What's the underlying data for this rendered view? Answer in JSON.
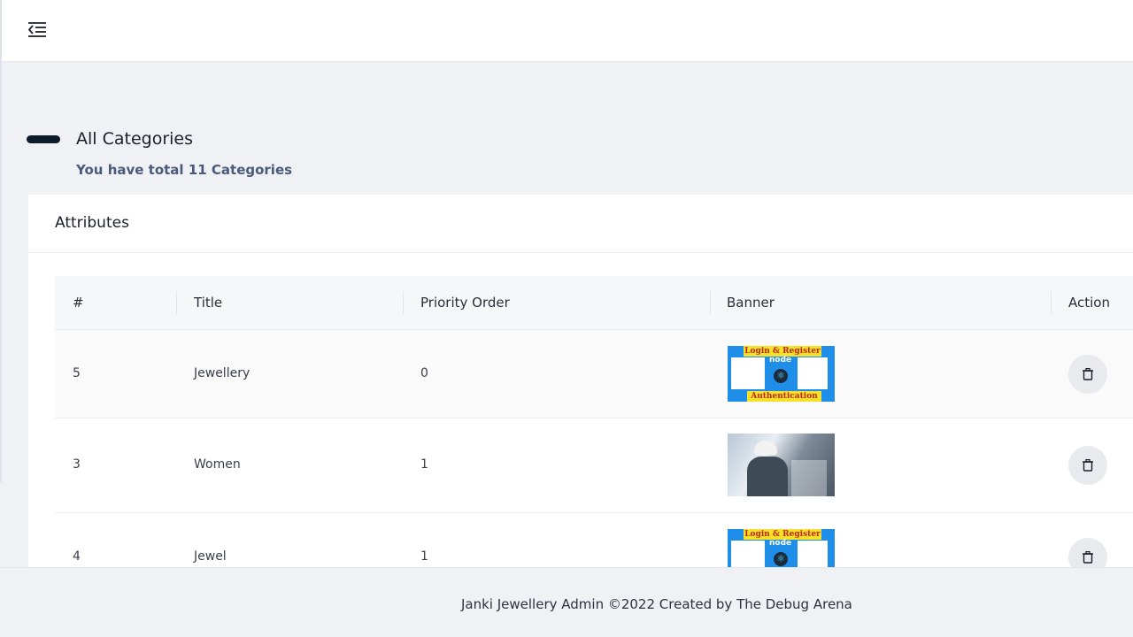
{
  "header": {
    "menu_icon": "menu-collapse-icon"
  },
  "page": {
    "title": "All Categories",
    "subtitle": "You have total 11 Categories"
  },
  "card": {
    "title": "Attributes"
  },
  "table": {
    "columns": [
      "#",
      "Title",
      "Priority Order",
      "Banner",
      "Action"
    ],
    "rows": [
      {
        "id": "5",
        "title": "Jewellery",
        "priority": "0",
        "banner": "login-register-auth-banner",
        "action_icon": "trash-icon"
      },
      {
        "id": "3",
        "title": "Women",
        "priority": "1",
        "banner": "engineer-city-photo-banner",
        "action_icon": "trash-icon"
      },
      {
        "id": "4",
        "title": "Jewel",
        "priority": "1",
        "banner": "login-register-auth-banner",
        "action_icon": "trash-icon"
      }
    ]
  },
  "banner_text": {
    "top": "Login & Register",
    "bottom": "Authentication",
    "logo": "node"
  },
  "footer": {
    "text": "Janki Jewellery Admin ©2022 Created by The Debug Arena"
  },
  "colors": {
    "page_bg": "#f0f1f5",
    "accent_dark": "#0d1a2a",
    "subtitle": "#4a5a7a",
    "banner_blue": "#1f8ee8",
    "banner_yellow": "#f5e12a"
  }
}
